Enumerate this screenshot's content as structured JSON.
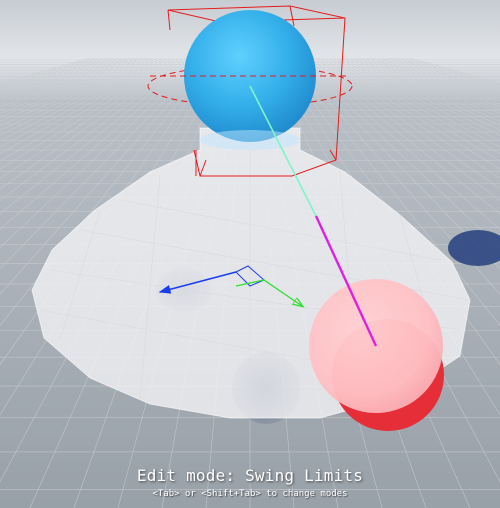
{
  "viewport": {
    "grid_color": "#c9cdd2",
    "floor_color": "#a3a9b0",
    "horizon_color": "#d9dce0",
    "cone_fill": "#f2f2f4",
    "limit_box_color": "#e41c1c",
    "parent_sphere_color": "#3cb4f0",
    "child_sphere_color": "#ffb7bb",
    "child_sphere_underside": "#e8303a",
    "twist_axis_color": "#7df5c8",
    "swing_axis_color": "#e020e0"
  },
  "hud": {
    "mode_label": "Edit mode: Swing Limits",
    "hint": "<Tab> or <Shift+Tab> to change modes"
  }
}
